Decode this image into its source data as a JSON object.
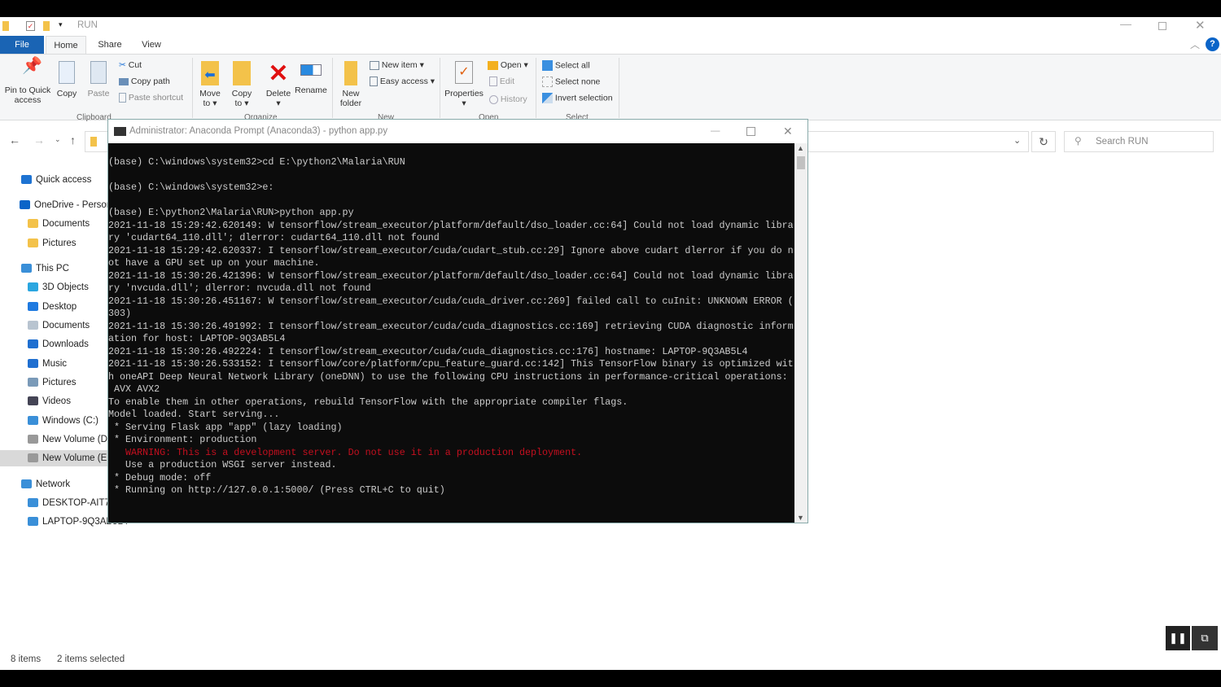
{
  "window": {
    "title": "RUN"
  },
  "tabs": [
    {
      "label": "File"
    },
    {
      "label": "Home"
    },
    {
      "label": "Share"
    },
    {
      "label": "View"
    }
  ],
  "ribbon": {
    "clipboard": {
      "group": "Clipboard",
      "pin": "Pin to Quick access",
      "copy": "Copy",
      "paste": "Paste",
      "cut": "Cut",
      "copy_path": "Copy path",
      "paste_shortcut": "Paste shortcut"
    },
    "organize": {
      "group": "Organize",
      "move_to": "Move to",
      "copy_to": "Copy to",
      "delete": "Delete",
      "rename": "Rename"
    },
    "new": {
      "group": "New",
      "new_folder": "New folder",
      "new_item": "New item",
      "easy_access": "Easy access"
    },
    "open": {
      "group": "Open",
      "properties": "Properties",
      "open": "Open",
      "edit": "Edit",
      "history": "History"
    },
    "select": {
      "group": "Select",
      "select_all": "Select all",
      "select_none": "Select none",
      "invert": "Invert selection"
    }
  },
  "search": {
    "placeholder": "Search RUN"
  },
  "sidebar": {
    "items": [
      {
        "label": "Quick access",
        "icon": "star-icon",
        "color": "#1e73d2"
      },
      {
        "label": "OneDrive - Personal",
        "icon": "cloud-icon",
        "color": "#0a64c8"
      },
      {
        "label": "Documents",
        "icon": "folder-icon",
        "color": "#f3c24a"
      },
      {
        "label": "Pictures",
        "icon": "folder-icon",
        "color": "#f3c24a"
      },
      {
        "label": "This PC",
        "icon": "computer-icon",
        "color": "#3a8fd8"
      },
      {
        "label": "3D Objects",
        "icon": "cube-icon",
        "color": "#2aa6e0"
      },
      {
        "label": "Desktop",
        "icon": "desktop-icon",
        "color": "#1f7ae0"
      },
      {
        "label": "Documents",
        "icon": "document-icon",
        "color": "#b8c4d0"
      },
      {
        "label": "Downloads",
        "icon": "download-icon",
        "color": "#1f6fd0"
      },
      {
        "label": "Music",
        "icon": "music-icon",
        "color": "#1f6fd0"
      },
      {
        "label": "Pictures",
        "icon": "picture-icon",
        "color": "#7a9ab8"
      },
      {
        "label": "Videos",
        "icon": "video-icon",
        "color": "#445"
      },
      {
        "label": "Windows (C:)",
        "icon": "drive-icon",
        "color": "#3a8fd8"
      },
      {
        "label": "New Volume (D:)",
        "icon": "drive-icon",
        "color": "#999"
      },
      {
        "label": "New Volume (E:)",
        "icon": "drive-icon",
        "color": "#999"
      },
      {
        "label": "Network",
        "icon": "network-icon",
        "color": "#3a8fd8"
      },
      {
        "label": "DESKTOP-AIT7I",
        "icon": "computer-icon",
        "color": "#3a8fd8"
      },
      {
        "label": "LAPTOP-9Q3AB5L4",
        "icon": "computer-icon",
        "color": "#3a8fd8"
      }
    ]
  },
  "cmd": {
    "title": "Administrator: Anaconda Prompt (Anaconda3) - python  app.py",
    "lines": [
      "(base) C:\\windows\\system32>cd E:\\python2\\Malaria\\RUN",
      "",
      "(base) C:\\windows\\system32>e:",
      "",
      "(base) E:\\python2\\Malaria\\RUN>python app.py",
      "2021-11-18 15:29:42.620149: W tensorflow/stream_executor/platform/default/dso_loader.cc:64] Could not load dynamic libra",
      "ry 'cudart64_110.dll'; dlerror: cudart64_110.dll not found",
      "2021-11-18 15:29:42.620337: I tensorflow/stream_executor/cuda/cudart_stub.cc:29] Ignore above cudart dlerror if you do n",
      "ot have a GPU set up on your machine.",
      "2021-11-18 15:30:26.421396: W tensorflow/stream_executor/platform/default/dso_loader.cc:64] Could not load dynamic libra",
      "ry 'nvcuda.dll'; dlerror: nvcuda.dll not found",
      "2021-11-18 15:30:26.451167: W tensorflow/stream_executor/cuda/cuda_driver.cc:269] failed call to cuInit: UNKNOWN ERROR (",
      "303)",
      "2021-11-18 15:30:26.491992: I tensorflow/stream_executor/cuda/cuda_diagnostics.cc:169] retrieving CUDA diagnostic inform",
      "ation for host: LAPTOP-9Q3AB5L4",
      "2021-11-18 15:30:26.492224: I tensorflow/stream_executor/cuda/cuda_diagnostics.cc:176] hostname: LAPTOP-9Q3AB5L4",
      "2021-11-18 15:30:26.533152: I tensorflow/core/platform/cpu_feature_guard.cc:142] This TensorFlow binary is optimized wit",
      "h oneAPI Deep Neural Network Library (oneDNN) to use the following CPU instructions in performance-critical operations:",
      " AVX AVX2",
      "To enable them in other operations, rebuild TensorFlow with the appropriate compiler flags.",
      "Model loaded. Start serving...",
      " * Serving Flask app \"app\" (lazy loading)",
      " * Environment: production",
      "   WARNING: This is a development server. Do not use it in a production deployment.",
      "   Use a production WSGI server instead.",
      " * Debug mode: off",
      " * Running on http://127.0.0.1:5000/ (Press CTRL+C to quit)"
    ],
    "warning_color": "#c50f1f"
  },
  "status": {
    "items": "8 items",
    "selected": "2 items selected"
  }
}
